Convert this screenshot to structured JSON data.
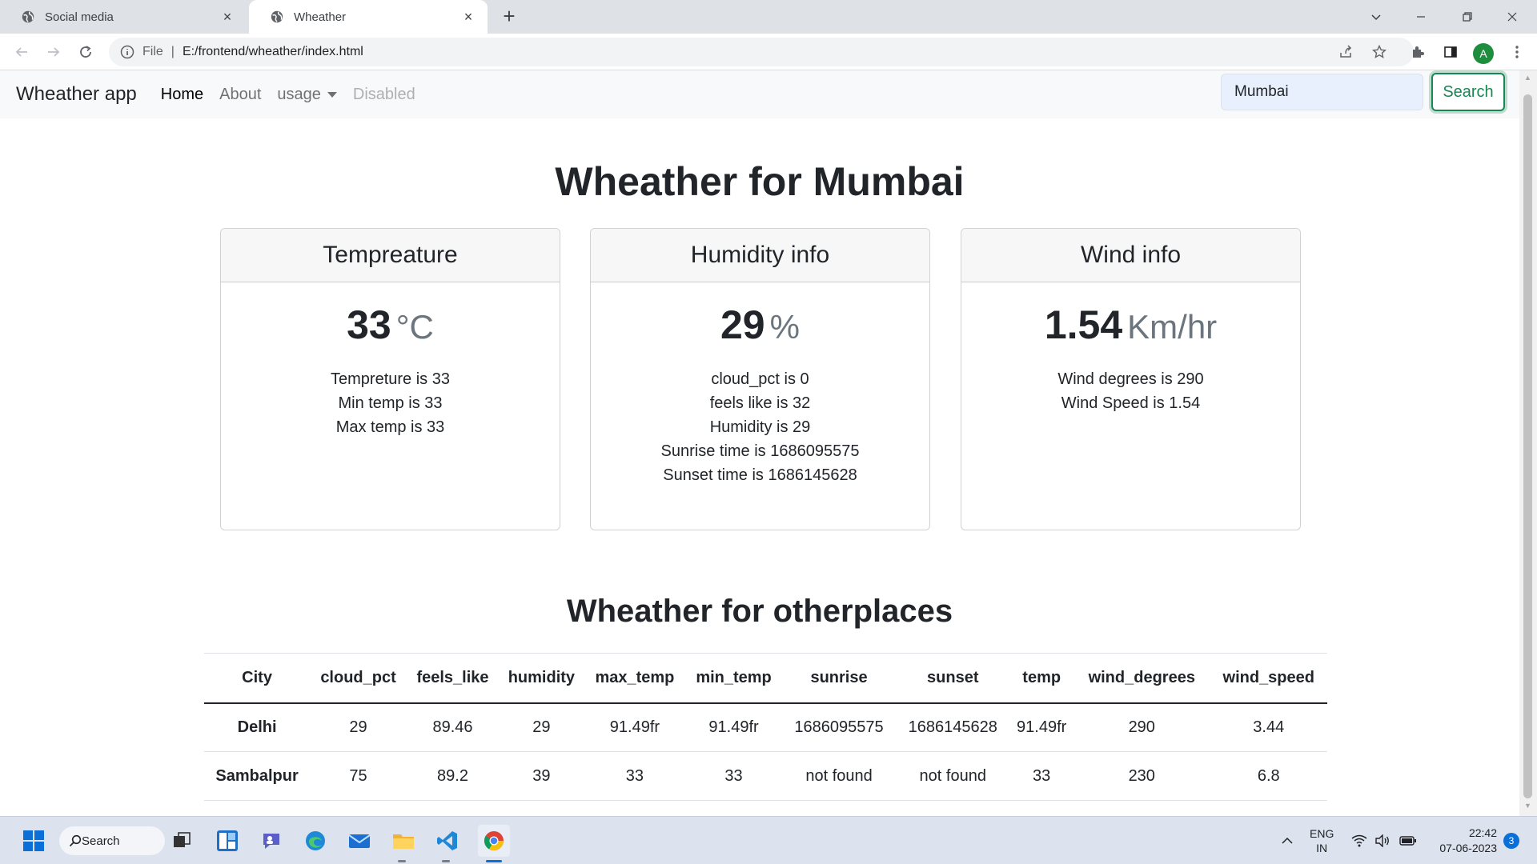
{
  "browser": {
    "tabs": [
      {
        "title": "Social media",
        "close": "×"
      },
      {
        "title": "Wheather",
        "close": "×"
      }
    ],
    "new_tab": "+",
    "scheme_label": "File",
    "url": "E:/frontend/wheather/index.html",
    "profile_initial": "A"
  },
  "navbar": {
    "brand": "Wheather app",
    "links": [
      "Home",
      "About",
      "usage",
      "Disabled"
    ],
    "search_value": "Mumbai",
    "search_button": "Search"
  },
  "main": {
    "title": "Wheather for Mumbai",
    "cards": [
      {
        "header": "Tempreature",
        "value": "33",
        "unit": "°C",
        "lines": [
          "Tempreture is 33",
          "Min temp is 33",
          "Max temp is 33"
        ]
      },
      {
        "header": "Humidity info",
        "value": "29",
        "unit": "%",
        "lines": [
          "cloud_pct is 0",
          "feels like is 32",
          "Humidity is 29",
          "Sunrise time is 1686095575",
          "Sunset time is 1686145628"
        ]
      },
      {
        "header": "Wind info",
        "value": "1.54",
        "unit": "Km/hr",
        "lines": [
          "Wind degrees is 290",
          "Wind Speed is 1.54"
        ]
      }
    ]
  },
  "other_places": {
    "title": "Wheather for otherplaces",
    "columns": [
      "City",
      "cloud_pct",
      "feels_like",
      "humidity",
      "max_temp",
      "min_temp",
      "sunrise",
      "sunset",
      "temp",
      "wind_degrees",
      "wind_speed"
    ],
    "rows": [
      [
        "Delhi",
        "29",
        "89.46",
        "29",
        "91.49fr",
        "91.49fr",
        "1686095575",
        "1686145628",
        "91.49fr",
        "290",
        "3.44"
      ],
      [
        "Sambalpur",
        "75",
        "89.2",
        "39",
        "33",
        "33",
        "not found",
        "not found",
        "33",
        "230",
        "6.8"
      ]
    ]
  },
  "taskbar": {
    "search_label": "Search",
    "lang": "ENG",
    "region": "IN",
    "time": "22:42",
    "date": "07-06-2023",
    "notifications": "3"
  }
}
